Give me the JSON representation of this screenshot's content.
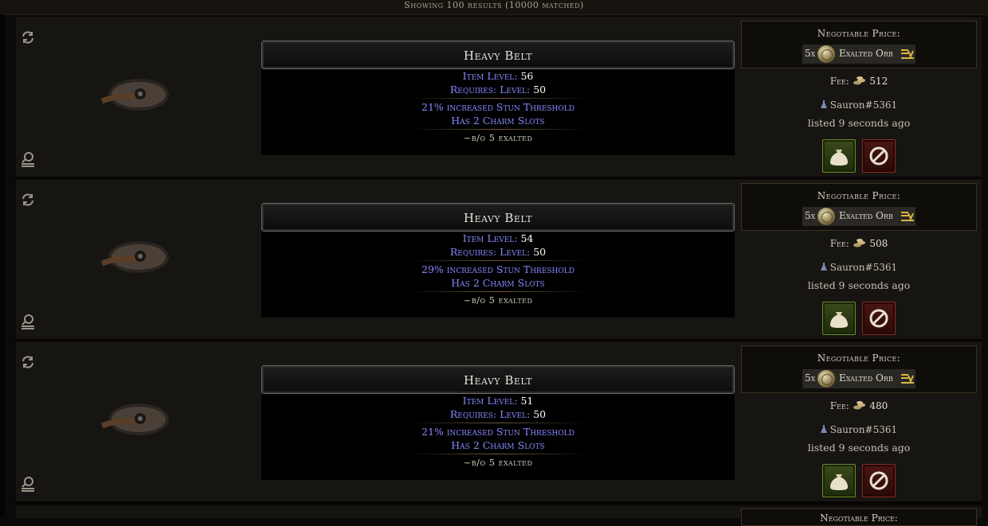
{
  "header": {
    "results_text": "Showing 100 results (10000 matched)"
  },
  "listings": [
    {
      "item_name": "Heavy Belt",
      "item_level_label": "Item Level: ",
      "item_level": "56",
      "requires_label": "Requires:  Level: ",
      "requires_level": "50",
      "mods": [
        "21% increased Stun Threshold",
        "Has 2 Charm Slots"
      ],
      "note": "~b/o 5 exalted",
      "price_title": "Negotiable Price:",
      "price_amount": "5x",
      "price_currency": "Exalted Orb",
      "fee_label": "Fee:",
      "fee_value": "512",
      "seller": "Sauron#5361",
      "listed": "listed 9 seconds ago"
    },
    {
      "item_name": "Heavy Belt",
      "item_level_label": "Item Level: ",
      "item_level": "54",
      "requires_label": "Requires:  Level: ",
      "requires_level": "50",
      "mods": [
        "29% increased Stun Threshold",
        "Has 2 Charm Slots"
      ],
      "note": "~b/o 5 exalted",
      "price_title": "Negotiable Price:",
      "price_amount": "5x",
      "price_currency": "Exalted Orb",
      "fee_label": "Fee:",
      "fee_value": "508",
      "seller": "Sauron#5361",
      "listed": "listed 9 seconds ago"
    },
    {
      "item_name": "Heavy Belt",
      "item_level_label": "Item Level: ",
      "item_level": "51",
      "requires_label": "Requires:  Level: ",
      "requires_level": "50",
      "mods": [
        "21% increased Stun Threshold",
        "Has 2 Charm Slots"
      ],
      "note": "~b/o 5 exalted",
      "price_title": "Negotiable Price:",
      "price_amount": "5x",
      "price_currency": "Exalted Orb",
      "fee_label": "Fee:",
      "fee_value": "480",
      "seller": "Sauron#5361",
      "listed": "listed 9 seconds ago"
    }
  ],
  "partial_listing": {
    "price_title": "Negotiable Price:"
  },
  "icons": {
    "refresh": "refresh-icon",
    "whisper": "whisper-icon",
    "exalted_orb": "exalted-orb-icon",
    "currency_equivalents": "currency-equivalent-icon",
    "coin": "coin-stack-icon",
    "buy": "money-bag-icon",
    "block": "block-icon",
    "online": "online-status-icon"
  },
  "colors": {
    "mod_text": "#8787fe",
    "buy_button": "#6a8a2c",
    "block_button": "#8a2a22"
  }
}
